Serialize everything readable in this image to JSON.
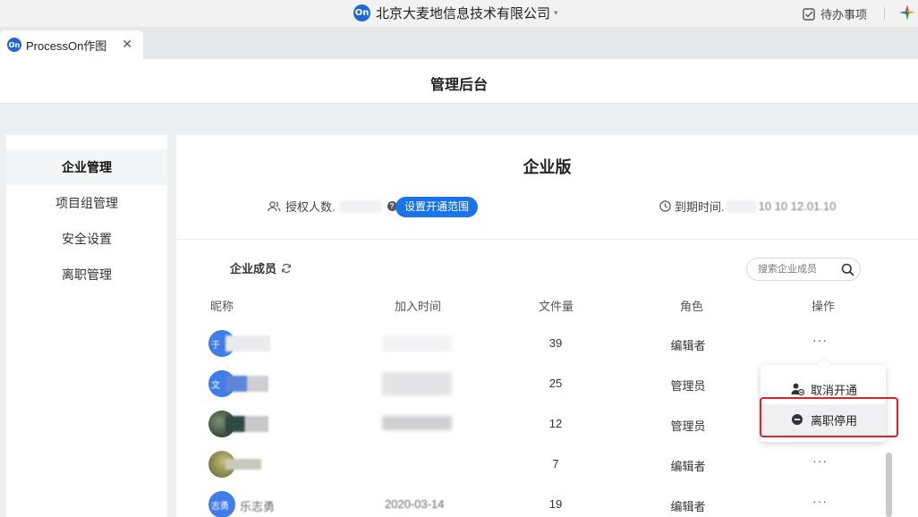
{
  "titlebar": {
    "logo_text": "On",
    "company": "北京大麦地信息技术有限公司",
    "todo_label": "待办事项"
  },
  "tab": {
    "logo_text": "On",
    "title": "ProcessOn作图",
    "close": "✕"
  },
  "header": {
    "title": "管理后台"
  },
  "sidebar": {
    "items": [
      {
        "label": "企业管理",
        "active": true
      },
      {
        "label": "项目组管理",
        "active": false
      },
      {
        "label": "安全设置",
        "active": false
      },
      {
        "label": "离职管理",
        "active": false
      }
    ]
  },
  "main": {
    "edition": "企业版",
    "license_label": "授权人数.",
    "scope_button": "设置开通范围",
    "expire_label": "到期时间.",
    "expire_value_partial": "10 10 12.01.10",
    "members_title": "企业成员",
    "search_placeholder": "搜索企业成员",
    "columns": {
      "nickname": "昵称",
      "join_time": "加入时间",
      "files": "文件量",
      "role": "角色",
      "actions": "操作"
    },
    "rows": [
      {
        "avatar_color": "#3f7de8",
        "avatar_text": "于",
        "files": "39",
        "role": "编辑者",
        "more": "···"
      },
      {
        "avatar_color": "#3f7de8",
        "avatar_text": "文",
        "files": "25",
        "role": "管理员",
        "more": ""
      },
      {
        "avatar_color": "#3b4a3e",
        "avatar_text": "",
        "files": "12",
        "role": "管理员",
        "more": ""
      },
      {
        "avatar_color": "#7a8a4a",
        "avatar_text": "",
        "files": "7",
        "role": "编辑者",
        "more": "···"
      },
      {
        "avatar_color": "#3f7de8",
        "avatar_text": "志勇",
        "name_partial": "乐志勇",
        "date_partial": "2020-03-14",
        "files": "19",
        "role": "编辑者",
        "more": "···"
      }
    ]
  },
  "menu": {
    "items": [
      {
        "label": "取消开通",
        "icon": "user-minus-icon"
      },
      {
        "label": "离职停用",
        "icon": "minus-circle-icon"
      }
    ]
  },
  "colors": {
    "accent": "#1a73e8",
    "highlight": "#e0202a"
  }
}
